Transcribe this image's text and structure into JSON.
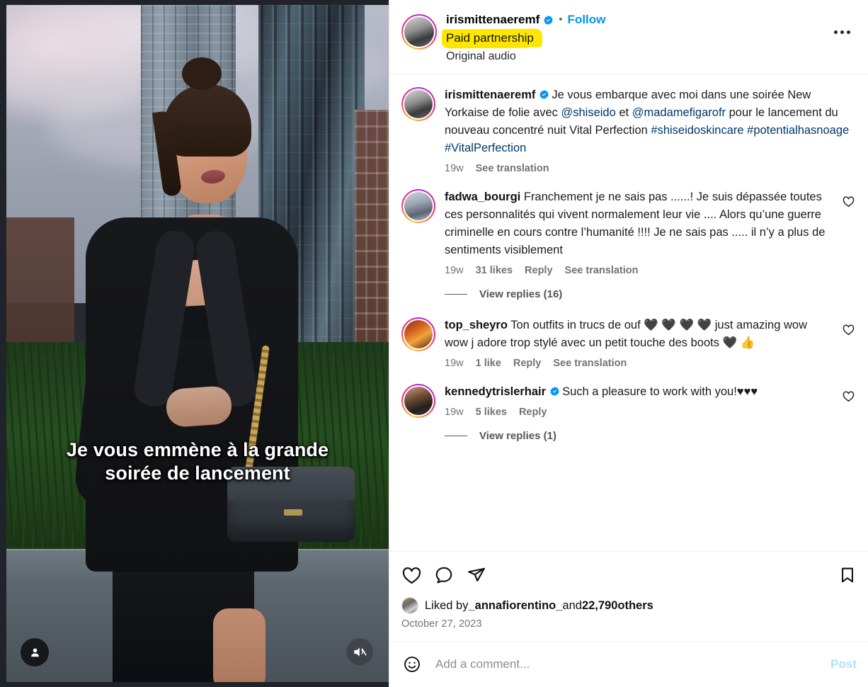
{
  "post": {
    "header": {
      "username": "irismittenaeremf",
      "verified": true,
      "separator": "•",
      "follow_label": "Follow",
      "paid_partnership": "Paid partnership",
      "audio": "Original audio",
      "more_icon": "more-options-icon",
      "highlight_color": "#ffe600",
      "link_color": "#0095f6"
    },
    "media": {
      "subtitle": "Je vous emmène à la grande\nsoirée de lancement",
      "tag_icon": "person-tag-icon",
      "mute_icon": "audio-muted-icon"
    },
    "caption": {
      "username": "irismittenaeremf",
      "verified": true,
      "segments": [
        {
          "type": "text",
          "value": "Je vous embarque avec moi dans une soirée New Yorkaise de folie avec "
        },
        {
          "type": "mention",
          "value": "@shiseido"
        },
        {
          "type": "text",
          "value": " et "
        },
        {
          "type": "mention",
          "value": "@madamefigarofr"
        },
        {
          "type": "text",
          "value": " pour le lancement du nouveau concentré nuit Vital Perfection "
        },
        {
          "type": "hashtag",
          "value": "#shiseidoskincare"
        },
        {
          "type": "text",
          "value": " "
        },
        {
          "type": "hashtag",
          "value": "#potentialhasnoage"
        },
        {
          "type": "text",
          "value": " "
        },
        {
          "type": "hashtag",
          "value": "#VitalPerfection"
        }
      ],
      "time": "19w",
      "translate_label": "See translation"
    },
    "comments": [
      {
        "username": "fadwa_bourgi",
        "verified": false,
        "text": "Franchement je ne sais pas ......! Je suis dépassée toutes ces personnalités qui vivent normalement leur vie .... Alors qu’une guerre criminelle en cours contre l’humanité !!!! Je ne sais pas ..... il n’y a plus de sentiments visiblement",
        "time": "19w",
        "likes": "31 likes",
        "reply_label": "Reply",
        "translate_label": "See translation",
        "replies_label": "View replies (16)"
      },
      {
        "username": "top_sheyro",
        "verified": false,
        "text": "Ton outfits in trucs de ouf 🖤 🖤 🖤 🖤 just amazing wow wow j adore trop stylé avec un petit touche des boots 🖤 👍",
        "time": "19w",
        "likes": "1 like",
        "reply_label": "Reply",
        "translate_label": "See translation",
        "replies_label": ""
      },
      {
        "username": "kennedytrislerhair",
        "verified": true,
        "text": "Such a pleasure to work with you!♥♥♥",
        "time": "19w",
        "likes": "5 likes",
        "reply_label": "Reply",
        "translate_label": "",
        "replies_label": "View replies (1)"
      }
    ],
    "actions": {
      "like_icon": "heart-icon",
      "comment_icon": "comment-bubble-icon",
      "share_icon": "share-paperplane-icon",
      "save_icon": "bookmark-icon"
    },
    "likes": {
      "prefix": "Liked by ",
      "user": "_annafiorentino_",
      "middle": " and ",
      "count": "22,790",
      "suffix": " others"
    },
    "date": "October 27, 2023",
    "add_comment": {
      "emoji_icon": "emoji-smiley-icon",
      "placeholder": "Add a comment...",
      "value": "",
      "post_label": "Post"
    }
  }
}
